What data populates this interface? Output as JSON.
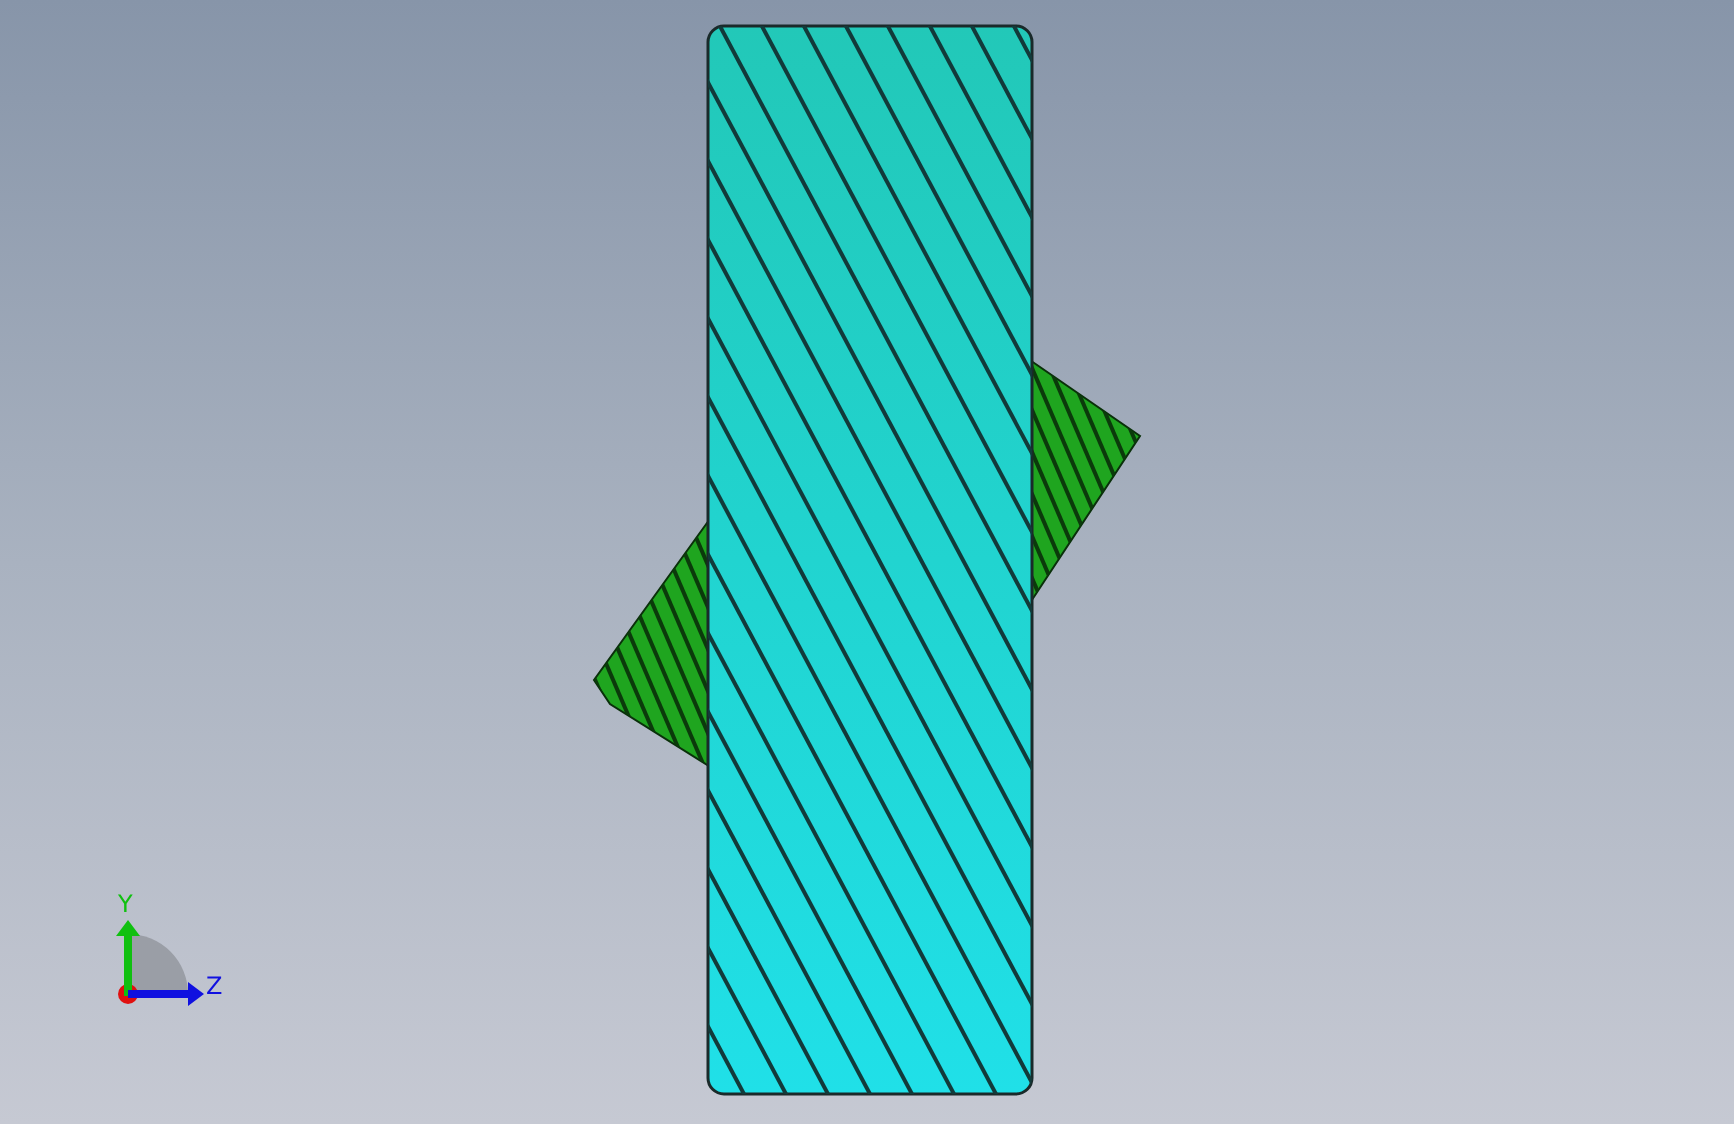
{
  "viewport": {
    "triad": {
      "axes": [
        {
          "kind": "vertical",
          "label": "Y",
          "color": "#10c010"
        },
        {
          "kind": "horizontal",
          "label": "Z",
          "color": "#1010e0"
        }
      ]
    }
  }
}
